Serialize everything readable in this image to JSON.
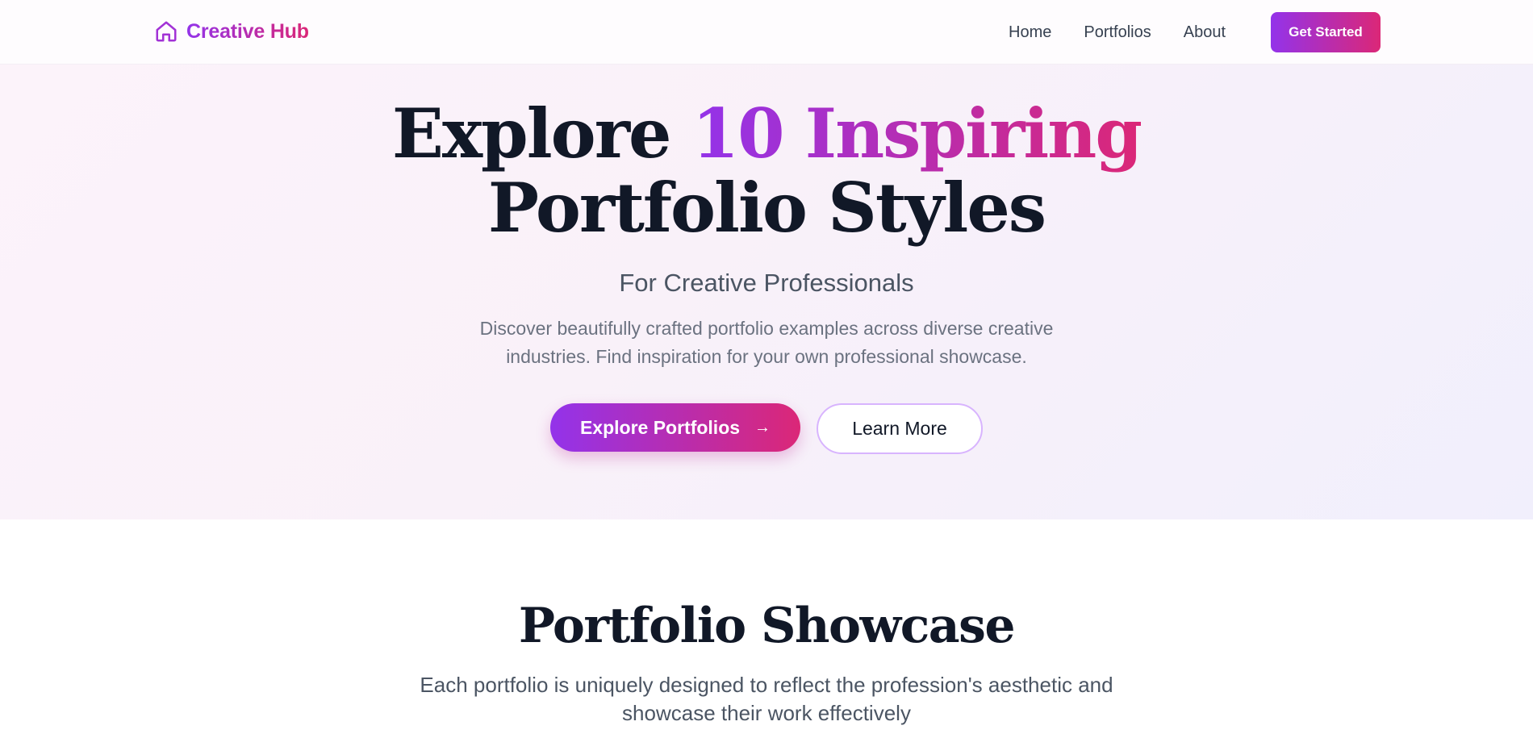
{
  "navbar": {
    "brand": "Creative Hub",
    "brand_icon": "home-icon",
    "links": [
      "Home",
      "Portfolios",
      "About"
    ],
    "cta_label": "Get Started"
  },
  "hero": {
    "title_line1_plain": "Explore ",
    "title_line1_accent": "10 Inspiring",
    "title_line2": "Portfolio Styles",
    "subtitle": "For Creative Professionals",
    "description": "Discover beautifully crafted portfolio examples across diverse creative industries. Find inspiration for your own professional showcase.",
    "primary_button": "Explore Portfolios",
    "primary_button_icon": "arrow-right-icon",
    "secondary_button": "Learn More"
  },
  "showcase": {
    "title": "Portfolio Showcase",
    "description": "Each portfolio is uniquely designed to reflect the profession's aesthetic and showcase their work effectively"
  },
  "colors": {
    "accent_start": "#9333ea",
    "accent_end": "#db2777",
    "text_dark": "#111827",
    "text_muted": "#6b7280"
  }
}
